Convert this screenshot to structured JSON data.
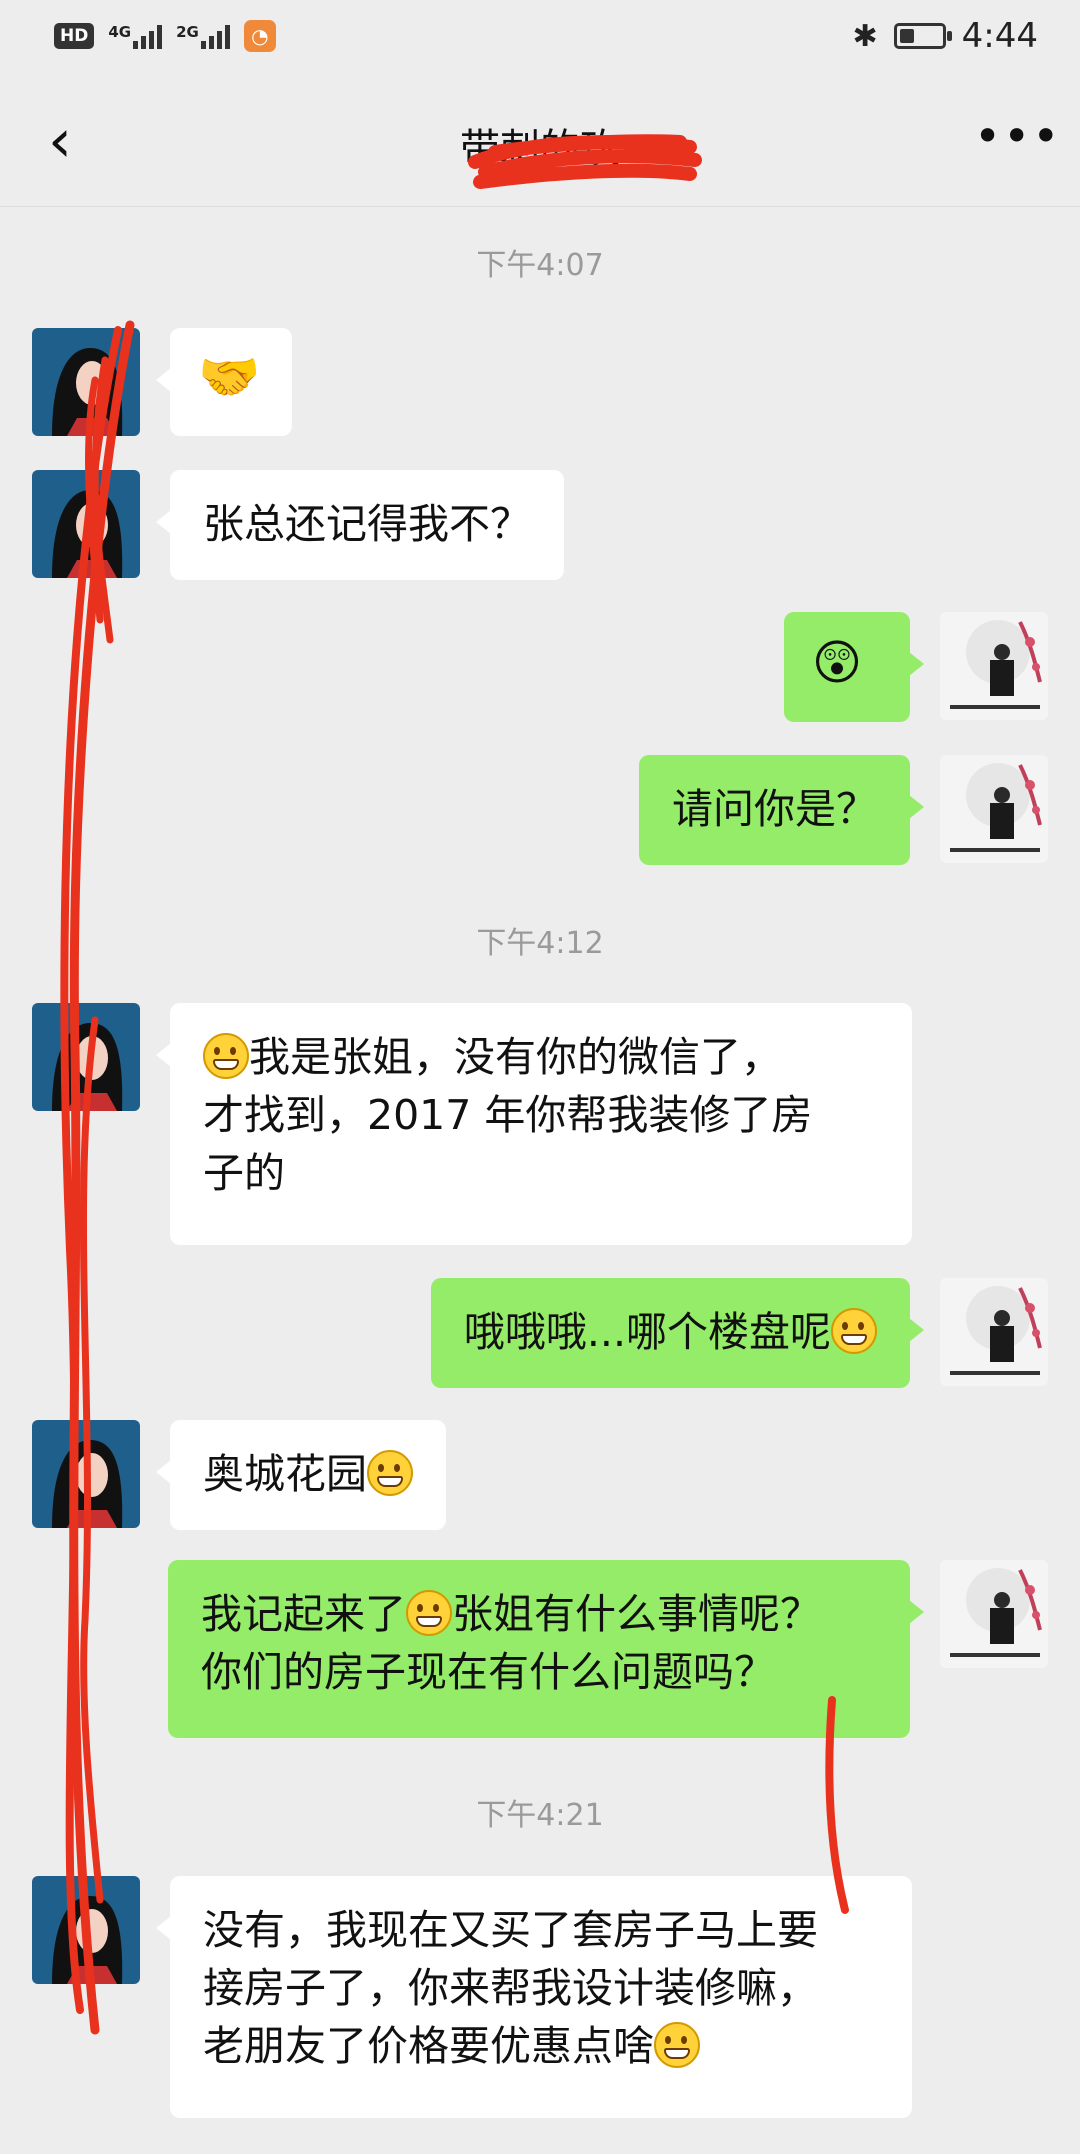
{
  "status_bar": {
    "hd": "HD",
    "network1": "4G",
    "network2": "2G",
    "time": "4:44",
    "bluetooth_icon": "bluetooth-icon",
    "battery_level": 0.35
  },
  "nav": {
    "back_icon": "chevron-left-icon",
    "title": "带刺的玫",
    "more_icon": "more-dots-icon"
  },
  "messages": {
    "ts1": "下午4:07",
    "m1_sticker": "🤝",
    "m2": "张总还记得我不？",
    "m3_sticker": "😲",
    "m4": "请问你是？",
    "ts2": "下午4:12",
    "m5_a": "我是张姐，没有你的微信了，",
    "m5_b": "才找到，2017 年你帮我装修了房",
    "m5_c": "子的",
    "m6": "哦哦哦...哪个楼盘呢",
    "m7": "奥城花园",
    "m8_a": "我记起来了",
    "m8_b": "张姐有什么事情呢？",
    "m8_c": "你们的房子现在有什么问题吗？",
    "ts3": "下午4:21",
    "m9_a": "没有，我现在又买了套房子马上要",
    "m9_b": "接房子了，你来帮我设计装修嘛，",
    "m9_c": "老朋友了价格要优惠点啥"
  },
  "colors": {
    "bg": "#ededed",
    "out_bubble": "#95ec69",
    "in_bubble": "#ffffff",
    "scribble": "#e8321e"
  }
}
